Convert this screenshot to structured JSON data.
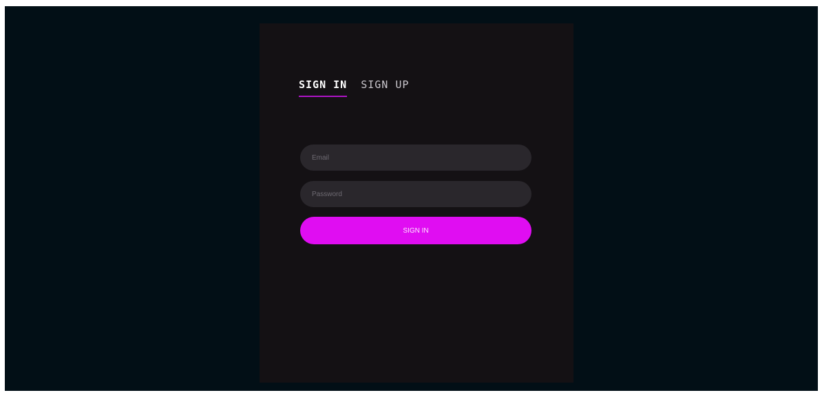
{
  "tabs": {
    "sign_in": "SIGN IN",
    "sign_up": "SIGN UP"
  },
  "form": {
    "email_placeholder": "Email",
    "password_placeholder": "Password",
    "submit_label": "SIGN IN"
  },
  "colors": {
    "accent": "#e00df2",
    "tab_underline": "#b014c8",
    "background": "#020f16",
    "card": "#141114",
    "field": "#2a272c"
  }
}
